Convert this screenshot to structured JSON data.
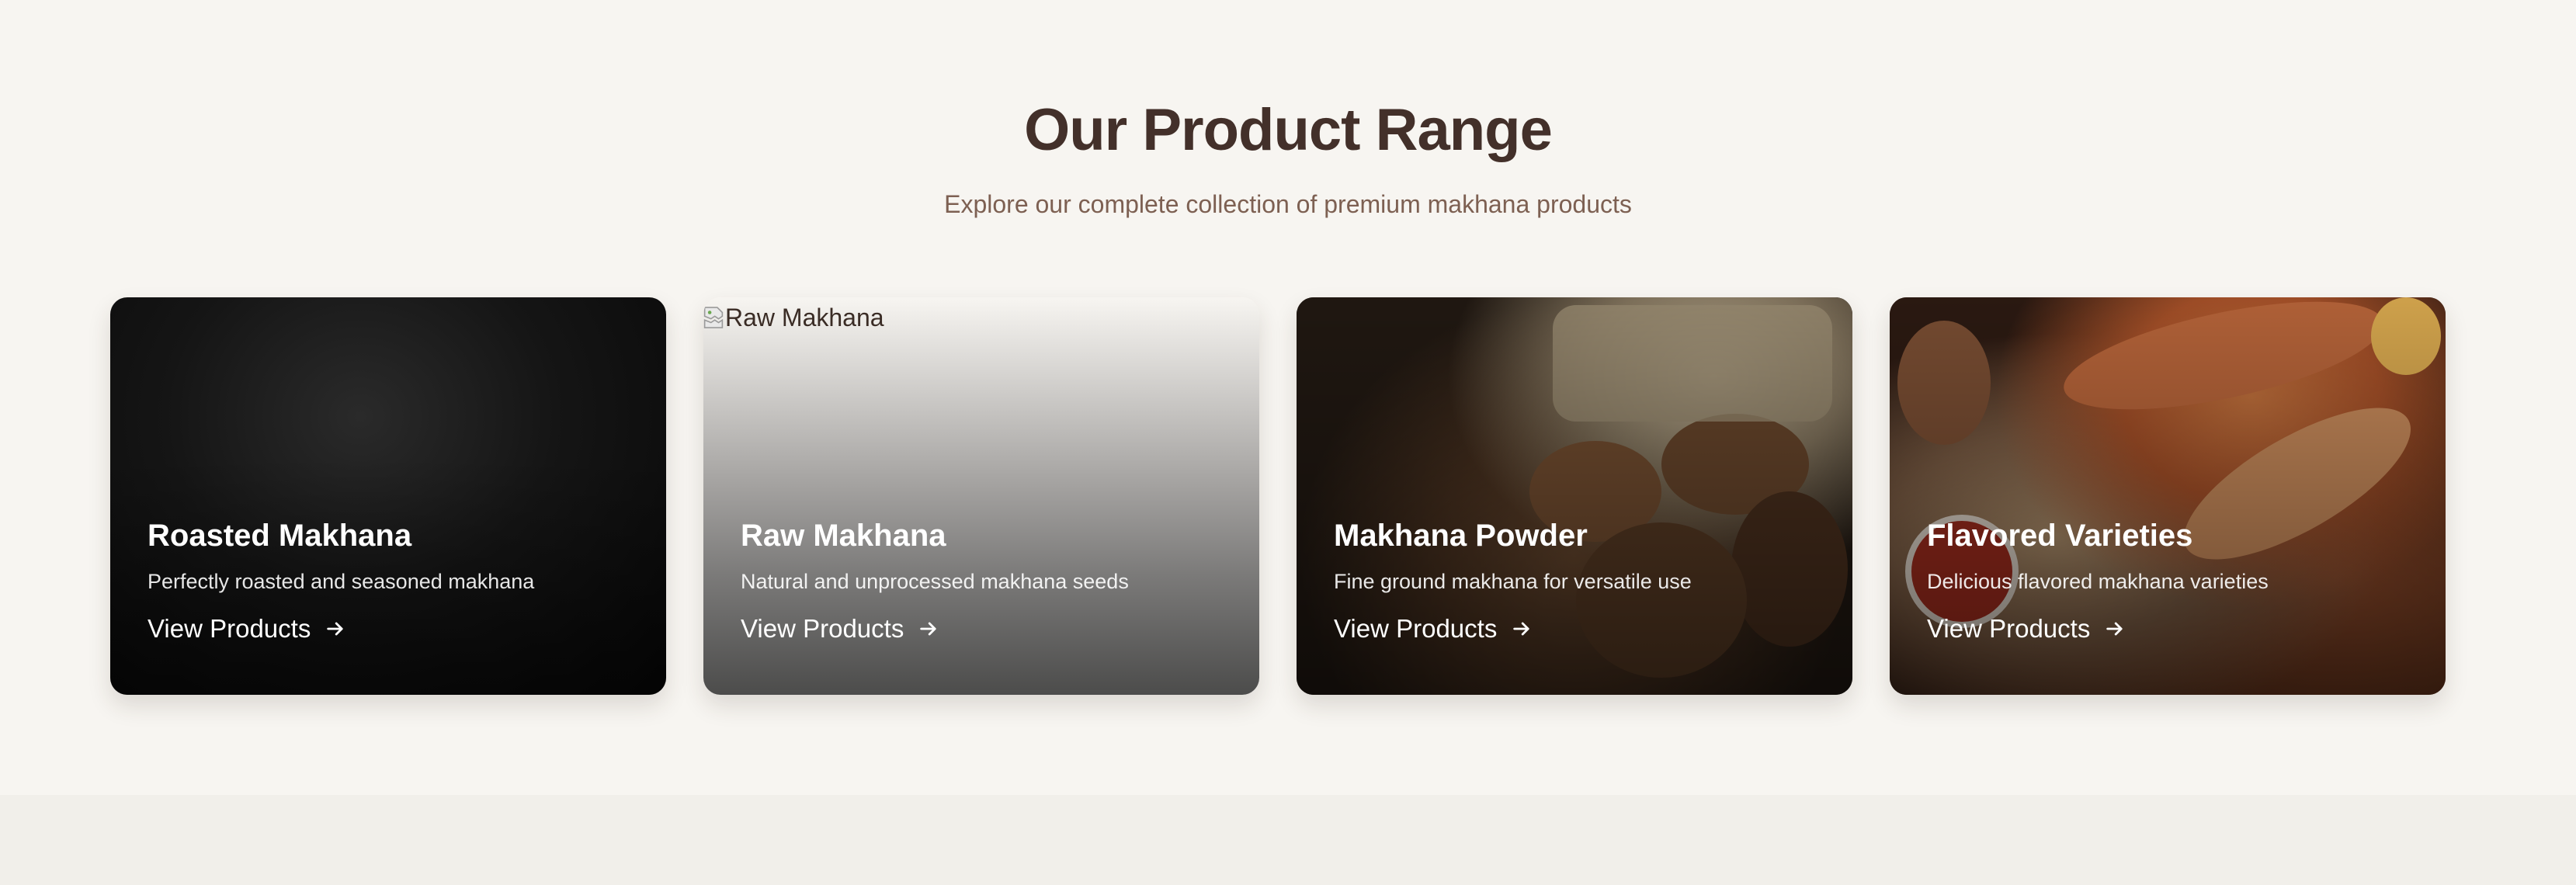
{
  "header": {
    "title": "Our Product Range",
    "subtitle": "Explore our complete collection of premium makhana products"
  },
  "cards": [
    {
      "title": "Roasted Makhana",
      "description": "Perfectly roasted and seasoned makhana",
      "link_label": "View Products"
    },
    {
      "title": "Raw Makhana",
      "description": "Natural and unprocessed makhana seeds",
      "link_label": "View Products",
      "image_alt": "Raw Makhana"
    },
    {
      "title": "Makhana Powder",
      "description": "Fine ground makhana for versatile use",
      "link_label": "View Products"
    },
    {
      "title": "Flavored Varieties",
      "description": "Delicious flavored makhana varieties",
      "link_label": "View Products"
    }
  ],
  "icons": {
    "link_arrow": "arrow-right-icon",
    "broken_image": "broken-image-icon"
  },
  "colors": {
    "page_background": "#f7f5f1",
    "heading": "#43302a",
    "subheading": "#7d6052",
    "card_text": "#ffffff"
  }
}
